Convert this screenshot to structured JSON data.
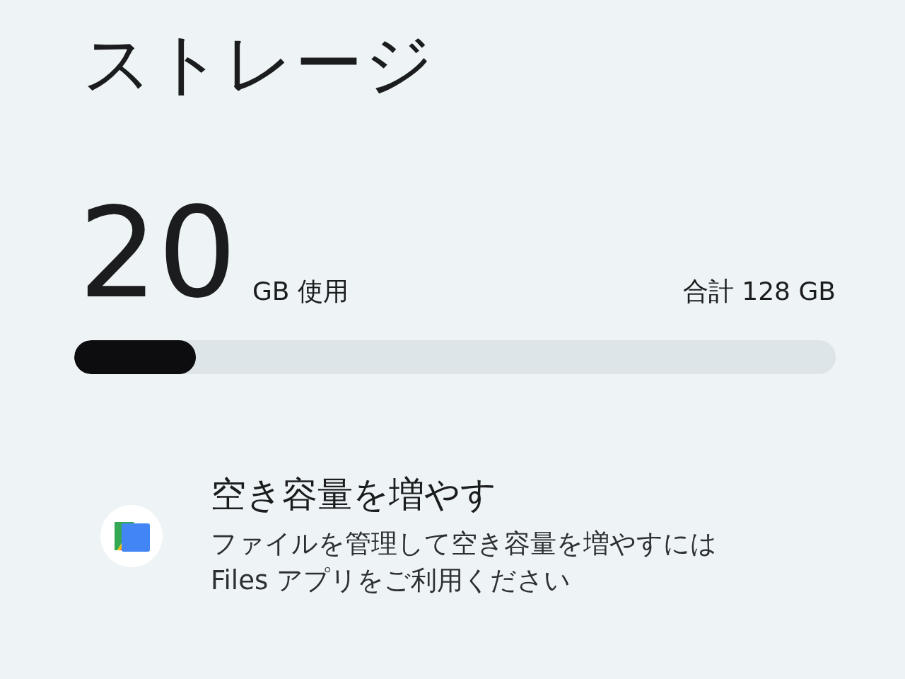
{
  "title": "ストレージ",
  "usage": {
    "used_value": "20",
    "used_unit": "GB 使用",
    "total": "合計 128 GB",
    "level": 0.16
  },
  "suggestion": {
    "title": "空き容量を増やす",
    "description": "ファイルを管理して空き容量を増やすには\nFiles アプリをご利用ください"
  }
}
